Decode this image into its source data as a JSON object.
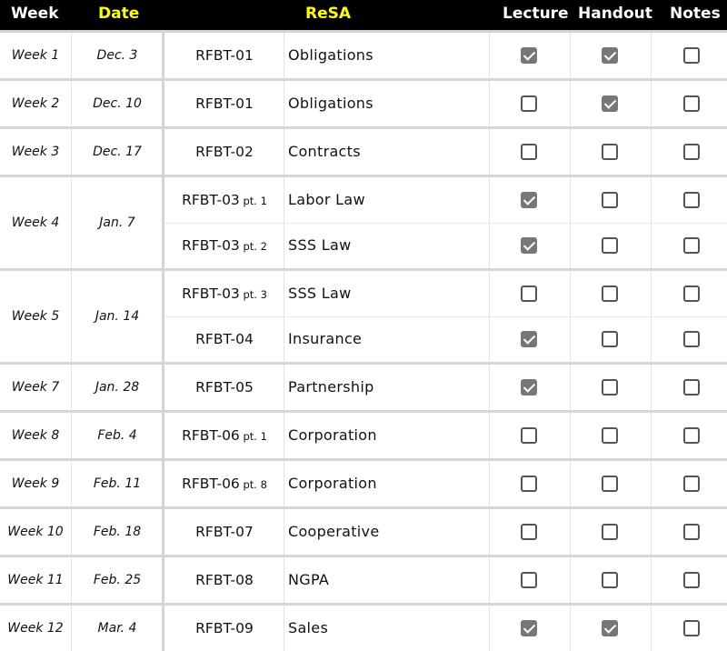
{
  "header": {
    "week": "Week",
    "date": "Date",
    "resa": "ReSA",
    "lecture": "Lecture",
    "handout": "Handout",
    "notes": "Notes"
  },
  "weeks": [
    {
      "week": "Week 1",
      "date": "Dec. 3",
      "rows": [
        {
          "code": "RFBT-01",
          "pt": "",
          "topic": "Obligations",
          "lecture": true,
          "handout": true,
          "notes": false
        }
      ]
    },
    {
      "week": "Week 2",
      "date": "Dec. 10",
      "rows": [
        {
          "code": "RFBT-01",
          "pt": "",
          "topic": "Obligations",
          "lecture": false,
          "handout": true,
          "notes": false
        }
      ]
    },
    {
      "week": "Week 3",
      "date": "Dec. 17",
      "rows": [
        {
          "code": "RFBT-02",
          "pt": "",
          "topic": "Contracts",
          "lecture": false,
          "handout": false,
          "notes": false
        }
      ]
    },
    {
      "week": "Week 4",
      "date": "Jan. 7",
      "rows": [
        {
          "code": "RFBT-03",
          "pt": "pt. 1",
          "topic": "Labor Law",
          "lecture": true,
          "handout": false,
          "notes": false
        },
        {
          "code": "RFBT-03",
          "pt": "pt. 2",
          "topic": "SSS Law",
          "lecture": true,
          "handout": false,
          "notes": false
        }
      ]
    },
    {
      "week": "Week 5",
      "date": "Jan. 14",
      "rows": [
        {
          "code": "RFBT-03",
          "pt": "pt. 3",
          "topic": "SSS Law",
          "lecture": false,
          "handout": false,
          "notes": false
        },
        {
          "code": "RFBT-04",
          "pt": "",
          "topic": "Insurance",
          "lecture": true,
          "handout": false,
          "notes": false
        }
      ]
    },
    {
      "week": "Week 7",
      "date": "Jan. 28",
      "rows": [
        {
          "code": "RFBT-05",
          "pt": "",
          "topic": "Partnership",
          "lecture": true,
          "handout": false,
          "notes": false
        }
      ]
    },
    {
      "week": "Week 8",
      "date": "Feb. 4",
      "rows": [
        {
          "code": "RFBT-06",
          "pt": "pt. 1",
          "topic": "Corporation",
          "lecture": false,
          "handout": false,
          "notes": false
        }
      ]
    },
    {
      "week": "Week 9",
      "date": "Feb. 11",
      "rows": [
        {
          "code": "RFBT-06",
          "pt": "pt. 8",
          "topic": "Corporation",
          "lecture": false,
          "handout": false,
          "notes": false
        }
      ]
    },
    {
      "week": "Week 10",
      "date": "Feb. 18",
      "rows": [
        {
          "code": "RFBT-07",
          "pt": "",
          "topic": "Cooperative",
          "lecture": false,
          "handout": false,
          "notes": false
        }
      ]
    },
    {
      "week": "Week 11",
      "date": "Feb. 25",
      "rows": [
        {
          "code": "RFBT-08",
          "pt": "",
          "topic": "NGPA",
          "lecture": false,
          "handout": false,
          "notes": false
        }
      ]
    },
    {
      "week": "Week 12",
      "date": "Mar. 4",
      "rows": [
        {
          "code": "RFBT-09",
          "pt": "",
          "topic": "Sales",
          "lecture": true,
          "handout": true,
          "notes": false
        }
      ]
    }
  ]
}
